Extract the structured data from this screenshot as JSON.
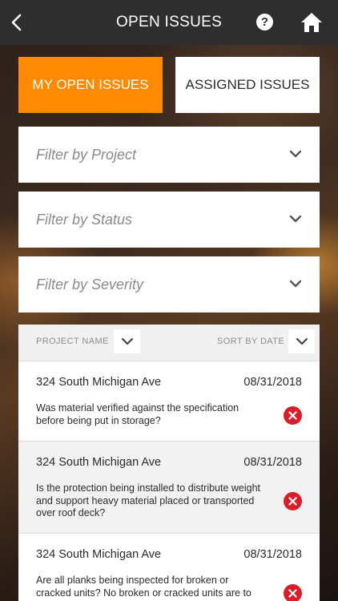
{
  "header": {
    "title": "OPEN ISSUES",
    "help_glyph": "?",
    "icons": {
      "back": "chevron-left-icon",
      "help": "question-circle-icon",
      "home": "home-icon"
    }
  },
  "tabs": [
    {
      "label": "MY OPEN ISSUES",
      "active": true
    },
    {
      "label": "ASSIGNED ISSUES",
      "active": false
    }
  ],
  "filters": [
    {
      "placeholder": "Filter by Project"
    },
    {
      "placeholder": "Filter by Status"
    },
    {
      "placeholder": "Filter by Severity"
    }
  ],
  "list": {
    "col_project": "PROJECT NAME",
    "col_sort": "SORT BY DATE",
    "issues": [
      {
        "project": "324 South Michigan Ave",
        "date": "08/31/2018",
        "question": "Was material verified against the specification before being put in storage?"
      },
      {
        "project": "324 South Michigan Ave",
        "date": "08/31/2018",
        "question": "Is the protection being installed to distribute weight and support heavy material placed or transported over roof deck?"
      },
      {
        "project": "324 South Michigan Ave",
        "date": "08/31/2018",
        "question": "Are all planks being inspected for broken or cracked units?  No broken or cracked units are to"
      }
    ]
  },
  "colors": {
    "header_bg": "#2e2e2e",
    "accent": "#ff8a00",
    "delete_red": "#d81e2a"
  }
}
